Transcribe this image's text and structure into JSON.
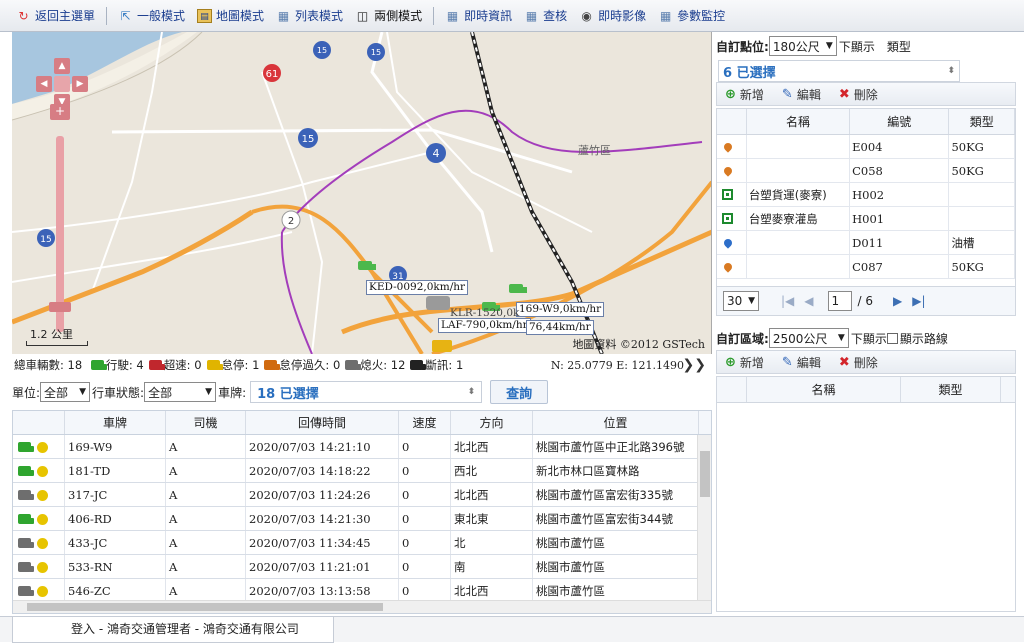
{
  "toolbar": {
    "items": [
      {
        "label": "返回主選單",
        "icon": "return-icon"
      },
      {
        "label": "一般模式",
        "icon": "general-mode-icon"
      },
      {
        "label": "地圖模式",
        "icon": "map-mode-icon"
      },
      {
        "label": "列表模式",
        "icon": "list-mode-icon"
      },
      {
        "label": "兩側模式",
        "icon": "split-mode-icon"
      },
      {
        "label": "即時資訊",
        "icon": "realtime-info-icon"
      },
      {
        "label": "查核",
        "icon": "audit-icon"
      },
      {
        "label": "即時影像",
        "icon": "camera-icon"
      },
      {
        "label": "參數監控",
        "icon": "monitor-icon"
      }
    ]
  },
  "map": {
    "road_labels": [
      "61",
      "15",
      "15",
      "15",
      "4",
      "2",
      "31",
      "15"
    ],
    "place_label": "蘆竹區",
    "vehicle_labels": [
      "KED-0092,0km/hr",
      "169-W9,0km/hr",
      "LAF-790,0km/hr",
      "76,44km/hr",
      "KLR-1520,0k"
    ],
    "scale": "1.2 公里",
    "copyright": "地圖資料 ©2012 GSTech"
  },
  "status_bar": {
    "total_label": "總車輛數:",
    "total": "18",
    "items": [
      {
        "label": "行駛:",
        "count": "4",
        "color": "#2fa52f"
      },
      {
        "label": "超速:",
        "count": "0",
        "color": "#c0272d"
      },
      {
        "label": "怠停:",
        "count": "1",
        "color": "#e0b400"
      },
      {
        "label": "怠停過久:",
        "count": "0",
        "color": "#d06a10"
      },
      {
        "label": "熄火:",
        "count": "12",
        "color": "#6e6e6e"
      },
      {
        "label": "斷訊:",
        "count": "1",
        "color": "#222222"
      }
    ],
    "coords": "N: 25.0779 E: 121.1490"
  },
  "filters": {
    "unit_label": "單位:",
    "unit_value": "全部",
    "status_label": "行車狀態:",
    "status_value": "全部",
    "plate_label": "車牌:",
    "plate_value": "18 已選擇",
    "query_label": "查詢"
  },
  "vehicle_table": {
    "headers": [
      "車牌",
      "司機",
      "回傳時間",
      "速度",
      "方向",
      "位置"
    ],
    "rows": [
      {
        "plate": "169-W9",
        "driver": "A",
        "time": "2020/07/03 14:21:10",
        "speed": "0",
        "dir": "北北西",
        "loc": "桃園市蘆竹區中正北路396號",
        "status": "#2fa52f"
      },
      {
        "plate": "181-TD",
        "driver": "A",
        "time": "2020/07/03 14:18:22",
        "speed": "0",
        "dir": "西北",
        "loc": "新北市林口區寶林路",
        "status": "#2fa52f"
      },
      {
        "plate": "317-JC",
        "driver": "A",
        "time": "2020/07/03 11:24:26",
        "speed": "0",
        "dir": "北北西",
        "loc": "桃園市蘆竹區富宏街335號",
        "status": "#6e6e6e"
      },
      {
        "plate": "406-RD",
        "driver": "A",
        "time": "2020/07/03 14:21:30",
        "speed": "0",
        "dir": "東北東",
        "loc": "桃園市蘆竹區富宏街344號",
        "status": "#2fa52f"
      },
      {
        "plate": "433-JC",
        "driver": "A",
        "time": "2020/07/03 11:34:45",
        "speed": "0",
        "dir": "北",
        "loc": "桃園市蘆竹區",
        "status": "#6e6e6e"
      },
      {
        "plate": "533-RN",
        "driver": "A",
        "time": "2020/07/03 11:21:01",
        "speed": "0",
        "dir": "南",
        "loc": "桃園市蘆竹區",
        "status": "#6e6e6e"
      },
      {
        "plate": "546-ZC",
        "driver": "A",
        "time": "2020/07/03 13:13:58",
        "speed": "0",
        "dir": "北北西",
        "loc": "桃園市蘆竹區",
        "status": "#6e6e6e"
      }
    ]
  },
  "right_panel": {
    "points": {
      "label": "自訂點位:",
      "range": "180公尺",
      "suffix": "下顯示",
      "type_label": "類型",
      "selected": "6 已選擇",
      "add": "新增",
      "edit": "編輯",
      "delete": "刪除",
      "headers": [
        "名稱",
        "編號",
        "類型"
      ],
      "rows": [
        {
          "icon": "orange-pin-icon",
          "name": "",
          "code": "E004",
          "type": "50KG"
        },
        {
          "icon": "orange-pin-icon",
          "name": "",
          "code": "C058",
          "type": "50KG"
        },
        {
          "icon": "green-square-icon",
          "name": "台塑貨運(麥寮)",
          "code": "H002",
          "type": ""
        },
        {
          "icon": "green-square-icon",
          "name": "台塑麥寮灌島",
          "code": "H001",
          "type": ""
        },
        {
          "icon": "blue-pin-icon",
          "name": "",
          "code": "D011",
          "type": "油槽"
        },
        {
          "icon": "orange-pin-icon",
          "name": "",
          "code": "C087",
          "type": "50KG"
        }
      ],
      "page_size": "30",
      "page": "1",
      "total_pages": "/ 6"
    },
    "areas": {
      "label": "自訂區域:",
      "range": "2500公尺",
      "suffix": "下顯示",
      "route_label": "顯示路線",
      "add": "新增",
      "edit": "編輯",
      "delete": "刪除",
      "headers": [
        "名稱",
        "類型"
      ]
    }
  },
  "footer": {
    "login": "登入 - 鴻奇交通管理者 - 鴻奇交通有限公司"
  }
}
